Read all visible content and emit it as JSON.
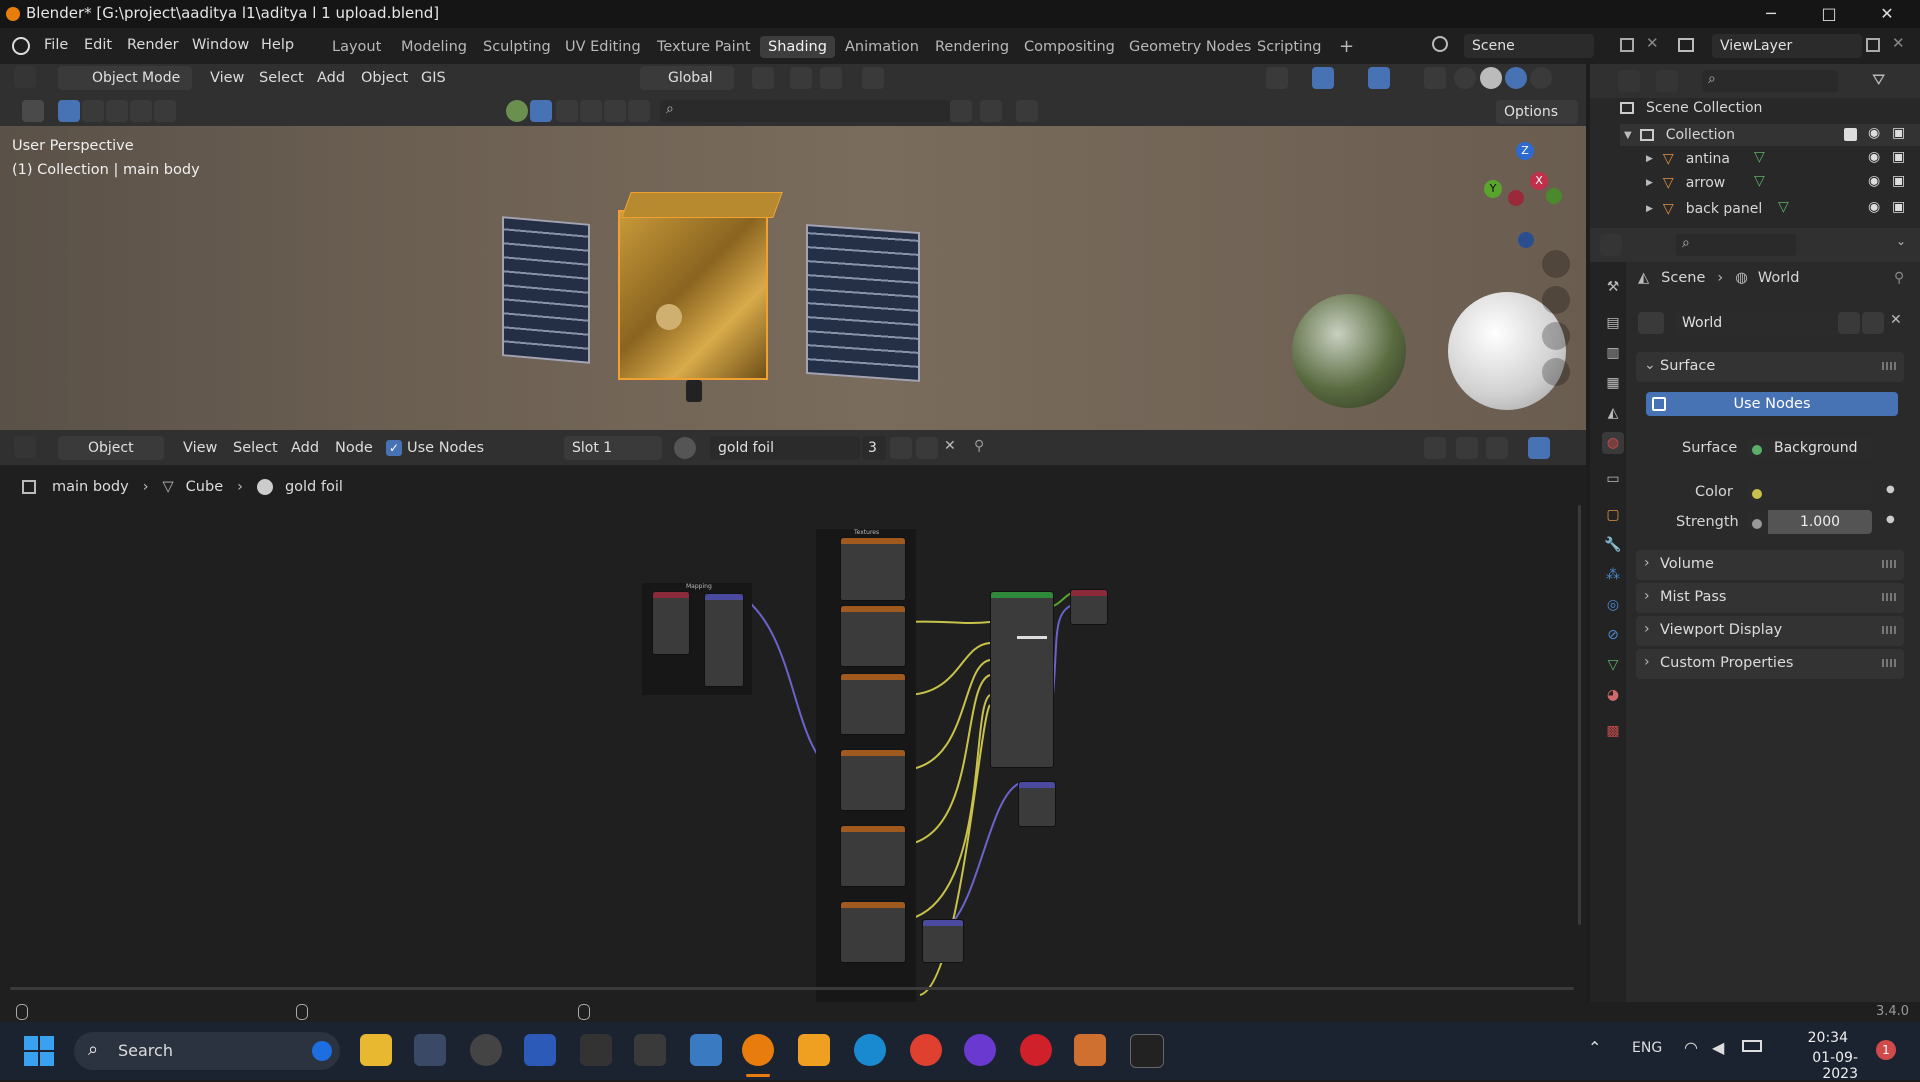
{
  "window": {
    "title": "Blender* [G:\\project\\aaditya l1\\aditya l 1 upload.blend]",
    "minimize": "─",
    "maximize": "□",
    "close": "✕"
  },
  "menu": [
    "File",
    "Edit",
    "Render",
    "Window",
    "Help"
  ],
  "workspaces": [
    "Layout",
    "Modeling",
    "Sculpting",
    "UV Editing",
    "Texture Paint",
    "Shading",
    "Animation",
    "Rendering",
    "Compositing",
    "Geometry Nodes",
    "Scripting"
  ],
  "workspace_add": "+",
  "active_workspace": "Shading",
  "scene_name": "Scene",
  "view_layer": "ViewLayer",
  "viewport_header": {
    "mode": "Object Mode",
    "menus": [
      "View",
      "Select",
      "Add",
      "Object",
      "GIS"
    ],
    "transform_orientation": "Global",
    "options": "Options"
  },
  "viewport": {
    "perspective": "User Perspective",
    "context": "(1) Collection | main body",
    "gizmo": {
      "x": "X",
      "y": "Y",
      "z": "Z"
    }
  },
  "node_header": {
    "type": "Object",
    "menus": [
      "View",
      "Select",
      "Add",
      "Node"
    ],
    "use_nodes": "Use Nodes",
    "slot": "Slot 1",
    "material": "gold foil",
    "users": "3"
  },
  "breadcrumb": [
    "main body",
    "Cube",
    "gold foil"
  ],
  "node_labels": {
    "textures": "Textures",
    "mapping": "Mapping"
  },
  "outliner": {
    "root": "Scene Collection",
    "collection": "Collection",
    "items": [
      "antina",
      "arrow",
      "back panel"
    ]
  },
  "properties": {
    "breadcrumb": [
      "Scene",
      "World"
    ],
    "world_name": "World",
    "surface_panel": "Surface",
    "use_nodes_button": "Use Nodes",
    "surface_label": "Surface",
    "surface_value": "Background",
    "color_label": "Color",
    "strength_label": "Strength",
    "strength_value": "1.000",
    "collapsed_panels": [
      "Volume",
      "Mist Pass",
      "Viewport Display",
      "Custom Properties"
    ]
  },
  "status": {
    "version": "3.4.0"
  },
  "taskbar": {
    "search": "Search",
    "lang": "ENG",
    "time": "20:34",
    "date": "01-09-2023",
    "notifications": "1"
  },
  "colors": {
    "accent_blue": "#4772b3",
    "node_wire_yellow": "#c8c24a",
    "node_wire_purple": "#6b63c9",
    "selection_orange": "#f2a030"
  }
}
